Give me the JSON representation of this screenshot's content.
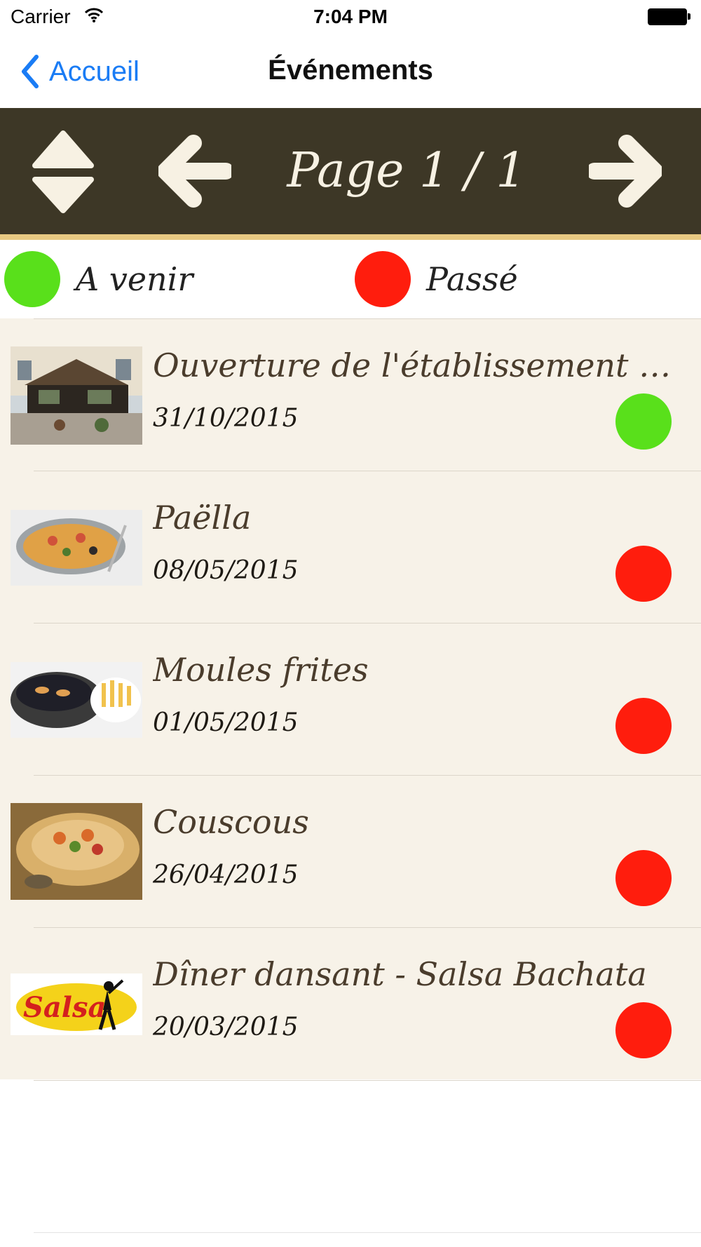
{
  "status_bar": {
    "carrier": "Carrier",
    "time": "7:04 PM"
  },
  "nav": {
    "back_label": "Accueil",
    "title": "Événements"
  },
  "pager": {
    "page_label": "Page 1 / 1"
  },
  "legend": [
    {
      "label": "A venir",
      "color": "#59e01b"
    },
    {
      "label": "Passé",
      "color": "#ff1d0d"
    }
  ],
  "events": [
    {
      "title": "Ouverture de l'établissement tou...",
      "date": "31/10/2015",
      "status": "upcoming",
      "status_color": "#59e01b"
    },
    {
      "title": "Paëlla",
      "date": "08/05/2015",
      "status": "past",
      "status_color": "#ff1d0d"
    },
    {
      "title": "Moules frites",
      "date": "01/05/2015",
      "status": "past",
      "status_color": "#ff1d0d"
    },
    {
      "title": "Couscous",
      "date": "26/04/2015",
      "status": "past",
      "status_color": "#ff1d0d"
    },
    {
      "title": "Dîner dansant - Salsa Bachata",
      "date": "20/03/2015",
      "status": "past",
      "status_color": "#ff1d0d"
    }
  ],
  "thumb_texts": {
    "salsa_logo": "Salsa"
  }
}
